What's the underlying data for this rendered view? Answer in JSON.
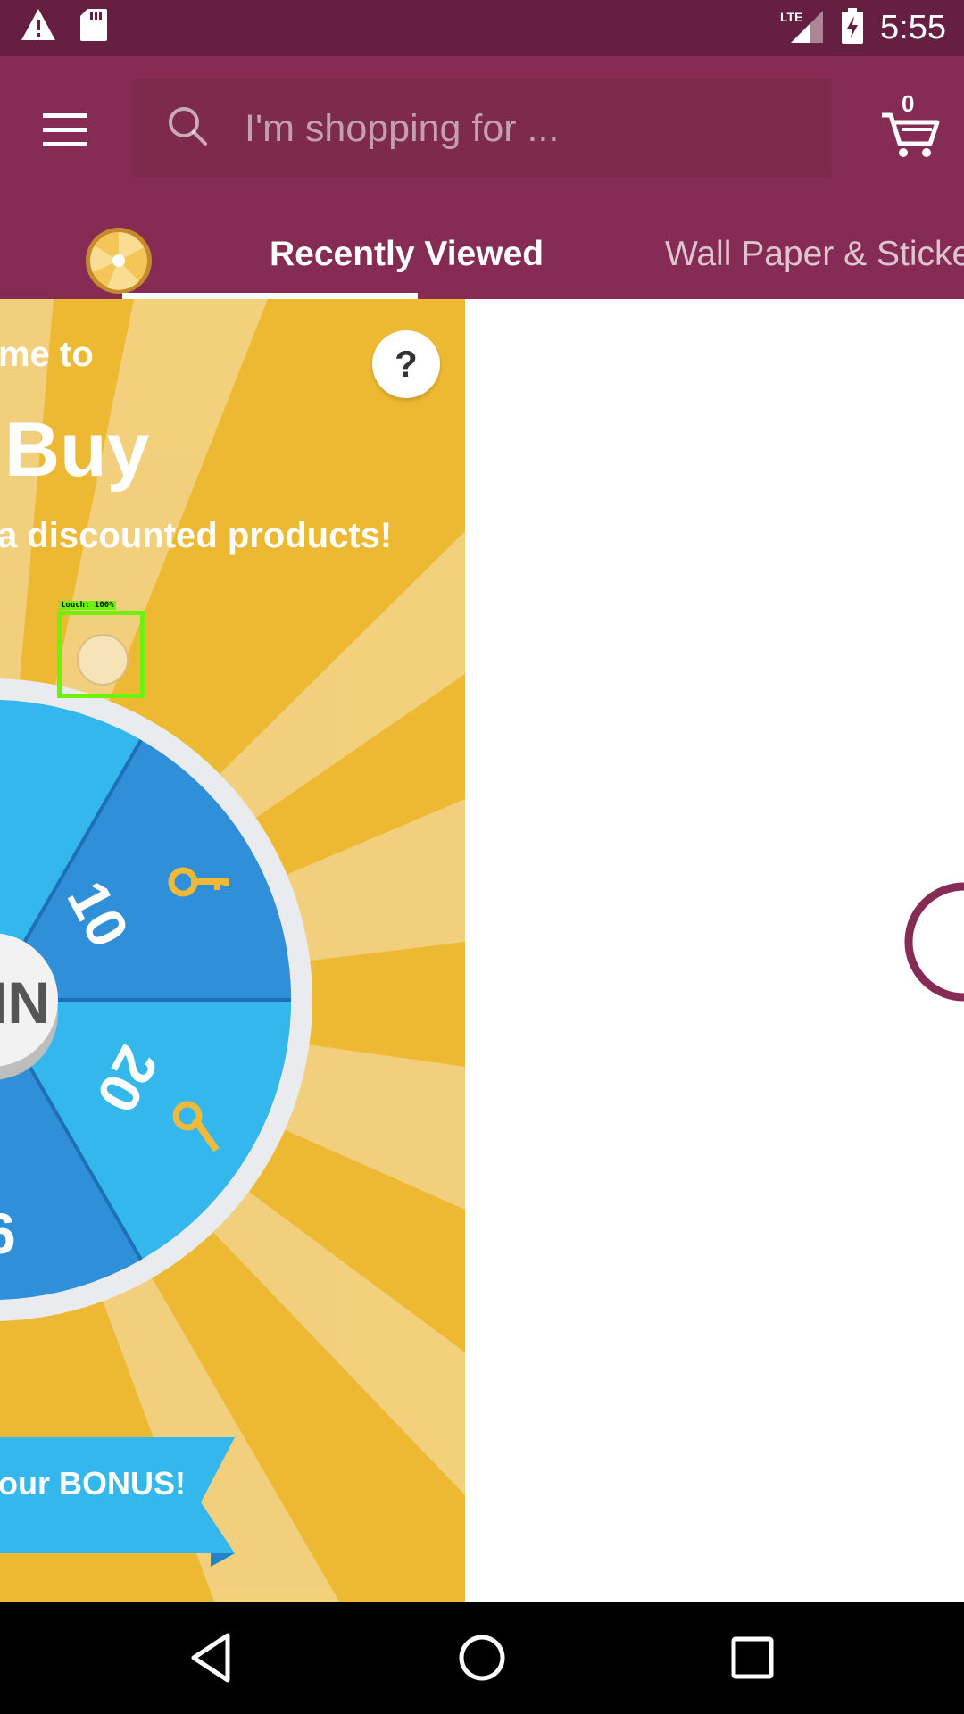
{
  "status_bar": {
    "time": "5:55",
    "network": "LTE",
    "icons": [
      "warning-icon",
      "sd-card-icon",
      "signal-icon",
      "battery-charging-icon"
    ]
  },
  "app_bar": {
    "search": {
      "placeholder": "I'm shopping for ...",
      "value": ""
    },
    "cart_count": "0",
    "icons": [
      "menu-icon",
      "search-icon",
      "cart-icon"
    ]
  },
  "tabs": [
    {
      "label": "Recently Viewed",
      "selected": true
    },
    {
      "label": "Wall Paper & Sticke",
      "selected": false
    }
  ],
  "game": {
    "welcome_line": "me to",
    "title": "Buy",
    "subtitle": "a discounted products!",
    "help": "?",
    "touch_label": "touch: 100%",
    "wheel": {
      "center_label": "IN",
      "segments": [
        "10",
        "20"
      ],
      "partial_segment": "6"
    },
    "bonus_text": "our BONUS!",
    "colors": {
      "background": "#edb933",
      "ray": "#f2d48a",
      "wheel_dark": "#2f8fd8",
      "wheel_light": "#33b7ec",
      "key": "#f0b93a"
    }
  },
  "accent_colors": {
    "status_bar": "#661f40",
    "app_bar": "#862b53",
    "spinner": "#862b53"
  },
  "nav_bar": {
    "icons": [
      "back-icon",
      "home-icon",
      "recents-icon"
    ]
  }
}
